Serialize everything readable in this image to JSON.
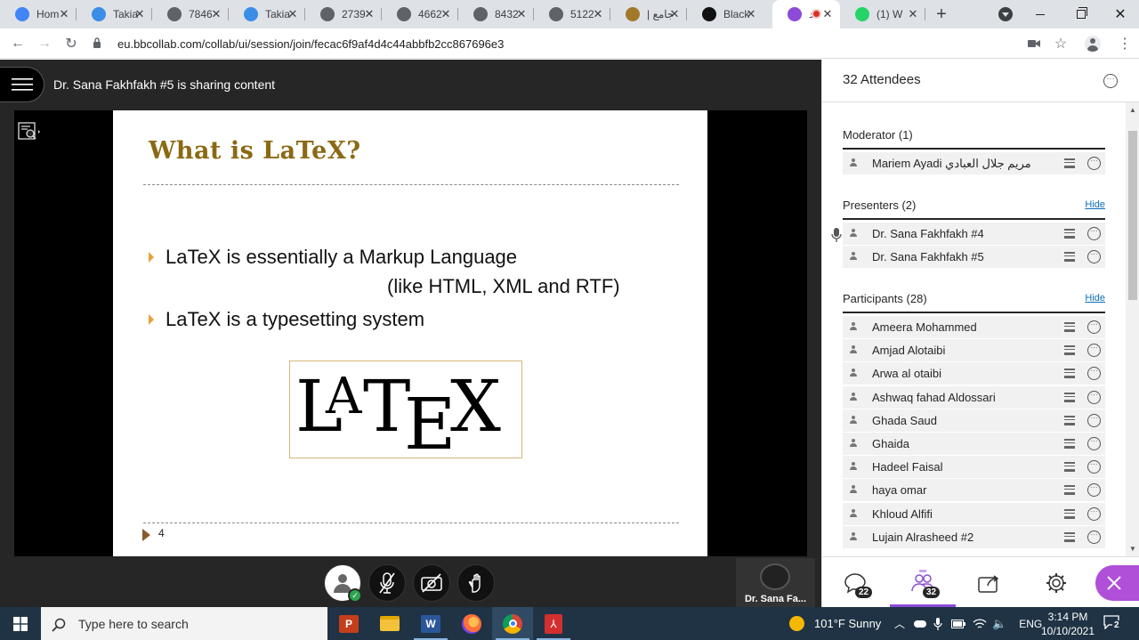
{
  "browser": {
    "tabs": [
      {
        "title": "Hom",
        "icon": "google-icon",
        "color": "#4285f4"
      },
      {
        "title": "Takia",
        "icon": "check-icon",
        "color": "#3a8ee6"
      },
      {
        "title": "7846",
        "icon": "globe-icon",
        "color": "#5f6368"
      },
      {
        "title": "Takia",
        "icon": "check-icon",
        "color": "#3a8ee6"
      },
      {
        "title": "2739",
        "icon": "globe-icon",
        "color": "#5f6368"
      },
      {
        "title": "4662",
        "icon": "globe-icon",
        "color": "#5f6368"
      },
      {
        "title": "8432",
        "icon": "globe-icon",
        "color": "#5f6368"
      },
      {
        "title": "5122",
        "icon": "globe-icon",
        "color": "#5f6368"
      },
      {
        "title": "| جامع",
        "icon": "university-icon",
        "color": "#a07a2a"
      },
      {
        "title": "Black",
        "icon": "bb-icon",
        "color": "#111111"
      },
      {
        "title": "د",
        "icon": "collab-icon",
        "color": "#8c4bd8"
      },
      {
        "title": "(1) W",
        "icon": "whatsapp-icon",
        "color": "#25d366"
      }
    ],
    "url": "eu.bbcollab.com/collab/ui/session/join/fecac6f9af4d4c44abbfb2cc867696e3"
  },
  "session": {
    "sharing_text": "Dr. Sana Fakhfakh #5 is sharing content",
    "video_name": "Dr. Sana Fa..."
  },
  "slide": {
    "title": "What is LaTeX?",
    "bullet1": "LaTeX is essentially a Markup Language",
    "bullet1_cont": "(like HTML, XML and RTF)",
    "bullet2": "LaTeX is a typesetting system",
    "page": "4"
  },
  "panel": {
    "title": "32 Attendees",
    "moderator_header": "Moderator (1)",
    "presenters_header": "Presenters (2)",
    "participants_header": "Participants (28)",
    "hide_label": "Hide",
    "moderators": [
      "Mariem Ayadi مريم جلال العبادي"
    ],
    "presenters": [
      "Dr. Sana Fakhfakh #4",
      "Dr. Sana Fakhfakh #5"
    ],
    "participants": [
      "Ameera Mohammed",
      "Amjad Alotaibi",
      "Arwa al otaibi",
      "Ashwaq fahad Aldossari",
      "Ghada Saud",
      "Ghaida",
      "Hadeel Faisal",
      "haya omar",
      "Khloud Alfifi",
      "Lujain Alrasheed #2"
    ],
    "chat_badge": "22",
    "attendees_badge": "32"
  },
  "taskbar": {
    "search_placeholder": "Type here to search",
    "weather": "101°F  Sunny",
    "lang": "ENG",
    "time": "3:14 PM",
    "date": "10/10/2021",
    "notif_count": "2"
  }
}
